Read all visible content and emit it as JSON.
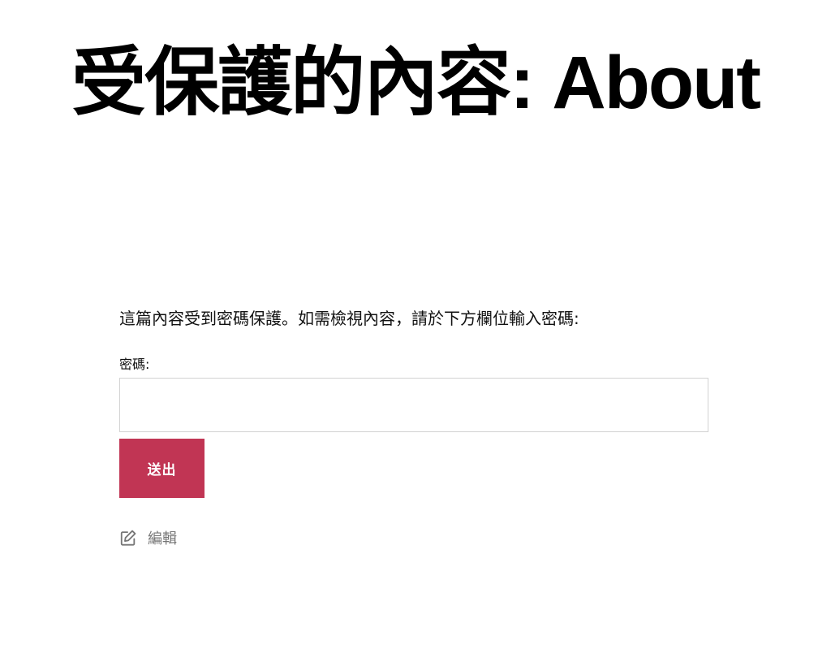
{
  "page": {
    "title": "受保護的內容: About"
  },
  "protected_form": {
    "notice": "這篇內容受到密碼保護。如需檢視內容，請於下方欄位輸入密碼:",
    "password_label": "密碼:",
    "password_value": "",
    "password_placeholder": "",
    "submit_label": "送出"
  },
  "edit_link": {
    "label": "編輯",
    "icon": "edit-icon"
  },
  "colors": {
    "accent": "#c13554",
    "muted_text": "#767676",
    "input_border": "#d2d2d2"
  }
}
